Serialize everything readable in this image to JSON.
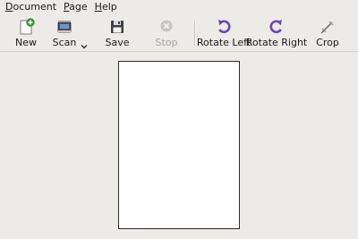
{
  "menubar": {
    "items": [
      {
        "mnemonic": "D",
        "rest": "ocument"
      },
      {
        "mnemonic": "P",
        "rest": "age"
      },
      {
        "mnemonic": "H",
        "rest": "elp"
      }
    ]
  },
  "toolbar": {
    "new_label": "New",
    "scan_label": "Scan",
    "save_label": "Save",
    "stop_label": "Stop",
    "rotate_left_label": "Rotate Left",
    "rotate_right_label": "Rotate Right",
    "crop_label": "Crop",
    "stop_disabled": true
  },
  "icons": {
    "new": "new-document-icon",
    "scan": "scanner-icon",
    "scan_menu": "chevron-down-icon",
    "save": "floppy-disk-icon",
    "stop": "stop-icon",
    "rotate_left": "rotate-left-icon",
    "rotate_right": "rotate-right-icon",
    "crop": "crop-icon"
  },
  "colors": {
    "background": "#edebe8",
    "rotate_accent": "#6a4aa8",
    "new_badge": "#3fa33a",
    "disabled_text": "#a6a4a0"
  }
}
